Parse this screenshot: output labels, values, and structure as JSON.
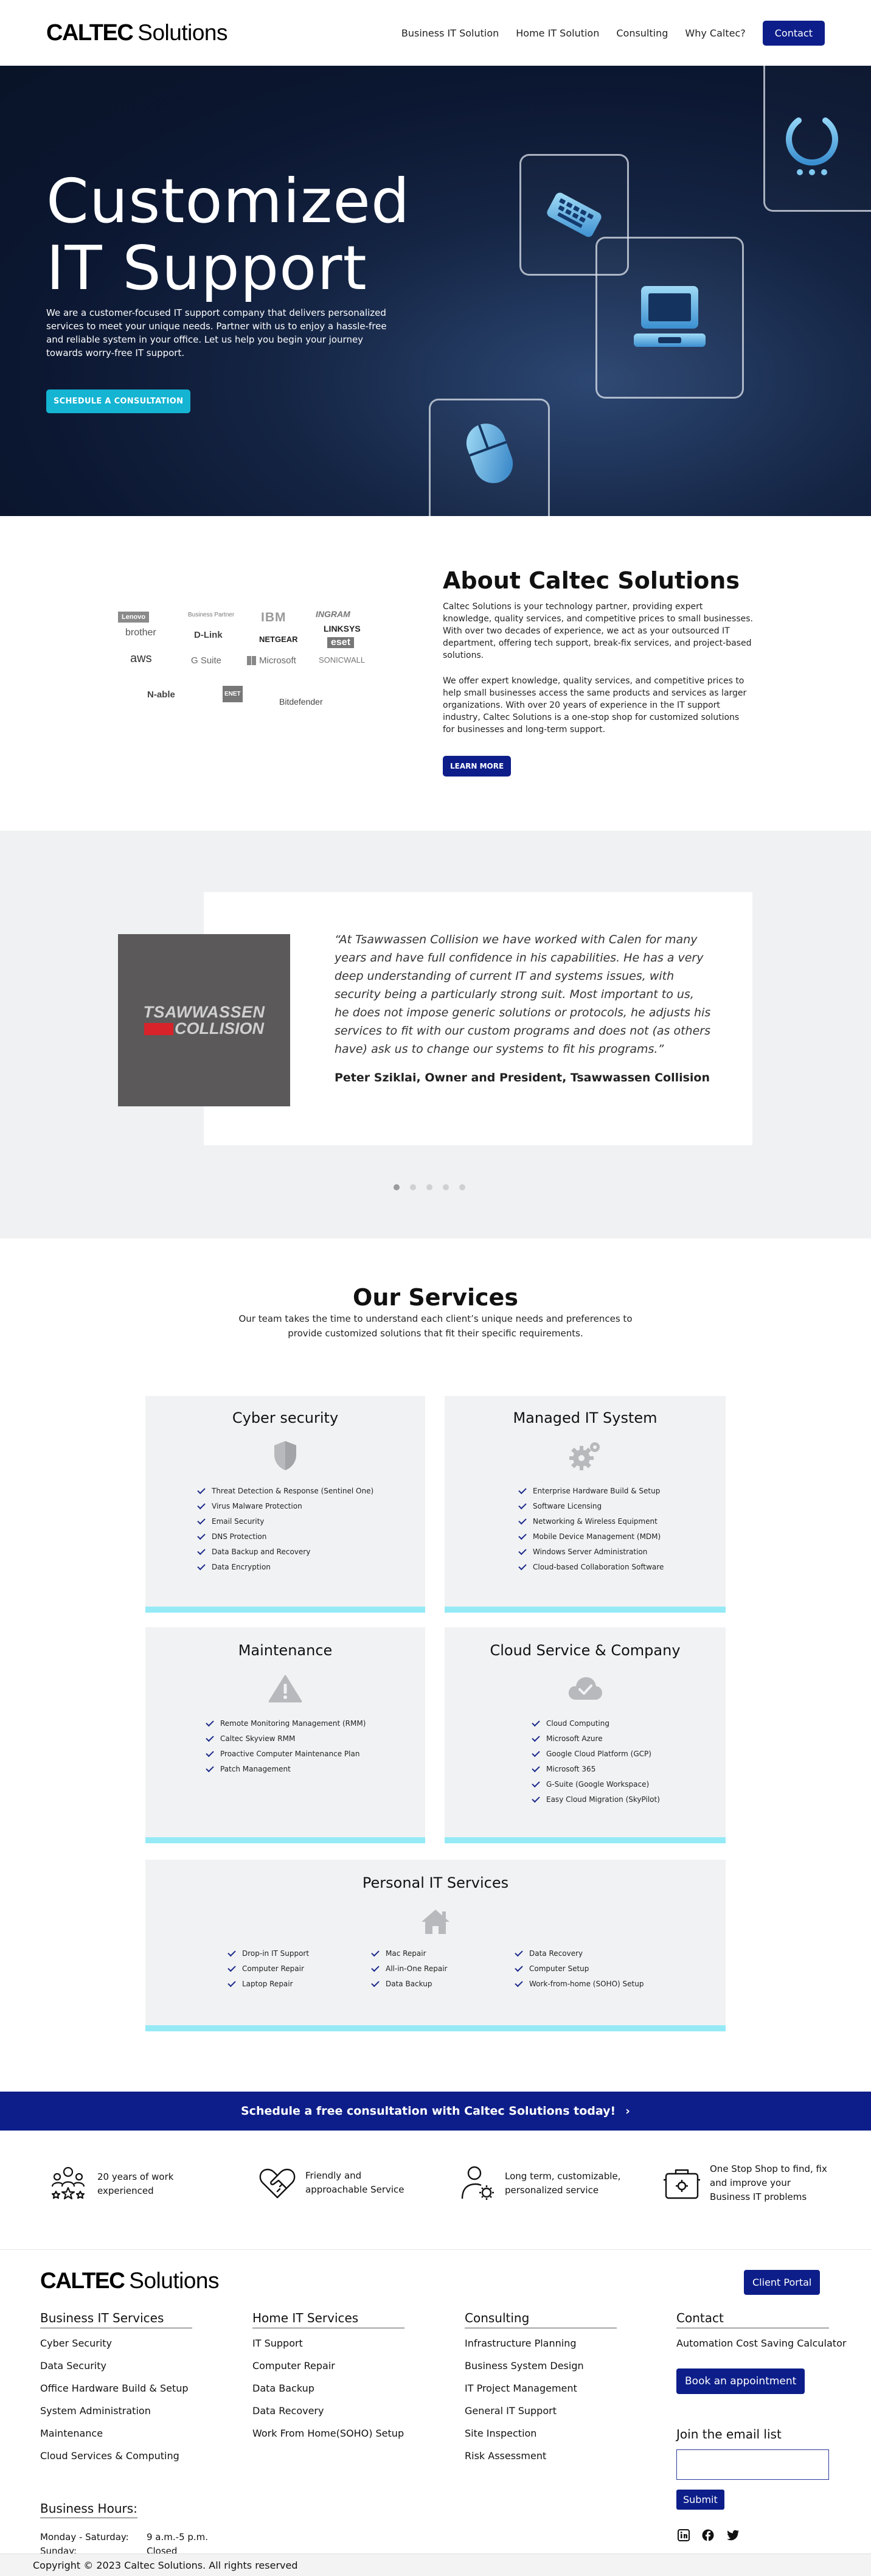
{
  "header": {
    "logo_mark": "CALTEC",
    "logo_word": "Solutions",
    "nav": [
      "Business IT Solution",
      "Home IT Solution",
      "Consulting",
      "Why Caltec?"
    ],
    "contact_label": "Contact"
  },
  "hero": {
    "title_line1": "Customized",
    "title_line2": "IT Support",
    "text": "We are a customer-focused IT support company that delivers personalized services to meet your unique needs. Partner with us to enjoy a hassle-free and reliable system in your office. Let us help you begin your journey towards worry-free IT support.",
    "cta": "SCHEDULE A CONSULTATION",
    "icons": [
      "power-icon",
      "keyboard-icon",
      "laptop-icon",
      "mouse-icon"
    ]
  },
  "partners": [
    "Lenovo",
    "Business Partner",
    "IBM",
    "INGRAM",
    "brother",
    "D-Link",
    "NETGEAR",
    "LINKSYS",
    "aws",
    "G Suite",
    "Microsoft",
    "eset",
    "SONICWALL",
    "N-able",
    "ENET",
    "Bitdefender"
  ],
  "about": {
    "title": "About Caltec Solutions",
    "p1": "Caltec Solutions is your technology partner, providing expert knowledge, quality services, and competitive prices to small businesses. With over two decades of experience, we act as your outsourced IT department, offering tech support, break-fix services, and project-based solutions.",
    "p2": "We offer expert knowledge, quality services, and competitive prices to help small businesses access the same products and services as larger organizations. With over 20 years of experience in the IT support industry, Caltec Solutions is a one-stop shop for customized solutions for businesses and long-term support.",
    "button": "LEARN MORE"
  },
  "testimonial": {
    "logo_line1": "TSAWWASSEN",
    "logo_line2": "COLLISION",
    "quote": "“At Tsawwassen Collision we have worked with Calen for many years and have full confidence in his capabilities. He has a very deep  understanding of current IT and systems issues, with security being a particularly strong suit.  Most important to us, he does not impose generic solutions or protocols, he adjusts his services to fit with our custom programs and does not (as others have) ask us to change our systems to fit his programs.”",
    "author": "Peter Sziklai, Owner and President, Tsawwassen Collision",
    "slides": 5,
    "active_slide": 1
  },
  "services": {
    "title": "Our Services",
    "subtitle": "Our team takes the time to understand each client’s unique needs and preferences to provide customized  solutions that fit their specific requirements.",
    "cyber": {
      "title": "Cyber security",
      "icon": "shield-icon",
      "items": [
        "Threat Detection & Response (Sentinel One)",
        "Virus Malware Protection",
        "Email Security",
        "DNS Protection",
        "Data Backup and Recovery",
        "Data Encryption"
      ]
    },
    "managed": {
      "title": "Managed IT System",
      "icon": "gears-icon",
      "items": [
        "Enterprise Hardware Build & Setup",
        "Software Licensing",
        "Networking & Wireless Equipment",
        "Mobile Device Management (MDM)",
        "Windows Server Administration",
        "Cloud-based Collaboration Software"
      ]
    },
    "maintenance": {
      "title": "Maintenance",
      "icon": "warning-icon",
      "items": [
        "Remote Monitoring Management (RMM)",
        "Caltec Skyview RMM",
        "Proactive Computer Maintenance Plan",
        "Patch Management"
      ]
    },
    "cloud": {
      "title": "Cloud Service & Company",
      "icon": "cloud-check-icon",
      "items": [
        "Cloud Computing",
        "Microsoft Azure",
        "Google Cloud Platform (GCP)",
        "Microsoft 365",
        "G-Suite (Google Workspace)",
        "Easy Cloud Migration (SkyPilot)"
      ]
    },
    "personal": {
      "title": "Personal IT Services",
      "icon": "home-icon",
      "col1": [
        "Drop-in IT Support",
        "Computer Repair",
        "Laptop Repair"
      ],
      "col2": [
        "Mac Repair",
        "All-in-One Repair",
        "Data Backup"
      ],
      "col3": [
        "Data Recovery",
        "Computer Setup",
        "Work-from-home (SOHO) Setup"
      ]
    }
  },
  "cta_strip": {
    "text": "Schedule a free consultation with Caltec Solutions today!",
    "chevron": "›"
  },
  "features": [
    {
      "icon": "team-stars-icon",
      "line1": "20 years of work",
      "line2": "experienced"
    },
    {
      "icon": "heart-handshake-icon",
      "line1": "Friendly and",
      "line2": "approachable Service"
    },
    {
      "icon": "user-gear-icon",
      "line1": "Long term, customizable,",
      "line2": "personalized service"
    },
    {
      "icon": "toolbox-icon",
      "line1": "One Stop Shop to find, fix",
      "line2": "and improve your",
      "line3": "Business IT problems"
    }
  ],
  "footer": {
    "logo_mark": "CALTEC",
    "logo_word": "Solutions",
    "portal": "Client Portal",
    "business": {
      "title": "Business IT Services",
      "items": [
        "Cyber Security",
        "Data Security",
        "Office Hardware Build & Setup",
        "System Administration",
        "Maintenance",
        "Cloud Services & Computing"
      ]
    },
    "home": {
      "title": "Home IT Services",
      "items": [
        "IT Support",
        "Computer Repair",
        "Data Backup",
        "Data Recovery",
        "Work From Home(SOHO) Setup"
      ]
    },
    "consulting": {
      "title": "Consulting",
      "items": [
        "Infrastructure Planning",
        "Business System Design",
        "IT Project Management",
        "General IT Support",
        "Site Inspection",
        "Risk Assessment"
      ]
    },
    "contact": {
      "title": "Contact",
      "calc": "Automation Cost Saving Calculator",
      "appointment": "Book an appointment"
    },
    "email_title": "Join the email list",
    "submit": "Submit",
    "hours_title": "Business Hours:",
    "hours": [
      {
        "day": "Monday - Saturday:",
        "time": "9 a.m.-5 p.m."
      },
      {
        "day": "Sunday:",
        "time": "Closed"
      }
    ],
    "social": [
      "linkedin-icon",
      "facebook-icon",
      "twitter-icon"
    ],
    "copyright": "Copyright © 2023 Caltec Solutions. All rights reserved"
  },
  "colors": {
    "brand": "#0d1e8a",
    "accent": "#14b4d2",
    "card_accent": "#95eaf5"
  }
}
